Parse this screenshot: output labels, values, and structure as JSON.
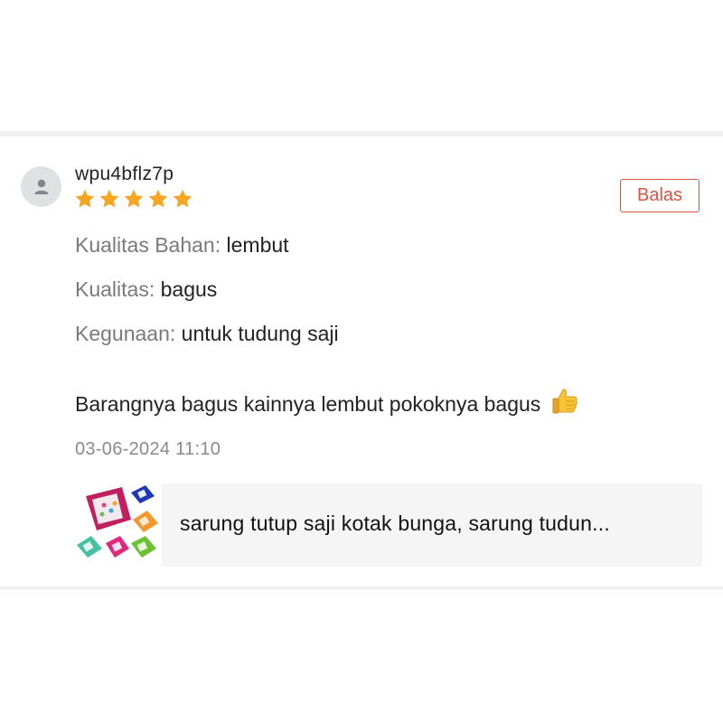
{
  "review": {
    "username": "wpu4bflz7p",
    "rating": 5,
    "reply_label": "Balas",
    "attributes": [
      {
        "label": "Kualitas Bahan:",
        "value": "lembut"
      },
      {
        "label": "Kualitas:",
        "value": "bagus"
      },
      {
        "label": "Kegunaan:",
        "value": "untuk tudung saji"
      }
    ],
    "text": "Barangnya bagus kainnya lembut pokoknya bagus",
    "timestamp": "03-06-2024 11:10"
  },
  "product": {
    "name": "sarung tutup saji kotak bunga, sarung tudun..."
  },
  "colors": {
    "star": "#f6a623",
    "accent": "#d8553f",
    "muted_text": "#7a7a7a"
  },
  "icons": {
    "avatar": "user-icon",
    "star": "star-icon",
    "emoji": "thumbs-up-icon"
  }
}
